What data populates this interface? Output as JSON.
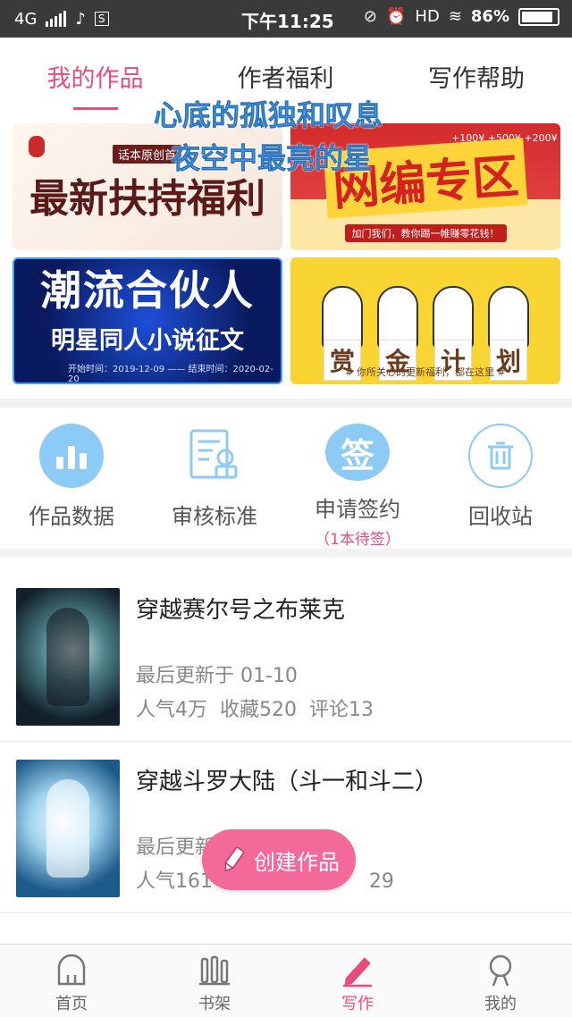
{
  "status_bar": {
    "network": "4G",
    "time": "下午11:25",
    "hd": "HD",
    "battery": "86%"
  },
  "tabs": [
    {
      "label": "我的作品",
      "active": true
    },
    {
      "label": "作者福利",
      "active": false
    },
    {
      "label": "写作帮助",
      "active": false
    }
  ],
  "overlay_lyrics": [
    "心底的孤独和叹息",
    "夜空中最亮的星"
  ],
  "banners": {
    "b1": {
      "title": "最新扶持福利",
      "tag": "话本原创首"
    },
    "b2": {
      "title": "网编专区",
      "coins": "+100¥  +500¥  +200¥",
      "subtitle": "加门我们，教你踢一帷赚零花钱！"
    },
    "b3": {
      "title": "潮流合伙人",
      "subtitle": "明星同人小说征文",
      "dates": "开始时间：2019-12-09 —— 结束时间：2020-02-20"
    },
    "b4": {
      "chars": [
        "赏",
        "金",
        "计",
        "划"
      ],
      "subtitle": "# 你所关心的更新福利，都在这里 #"
    }
  },
  "tools": [
    {
      "label": "作品数据",
      "icon": "bar-chart-icon"
    },
    {
      "label": "审核标准",
      "icon": "document-check-icon"
    },
    {
      "label": "申请签约",
      "icon": "sign-icon",
      "icon_char": "签",
      "sub": "（1本待签）"
    },
    {
      "label": "回收站",
      "icon": "trash-icon"
    }
  ],
  "works": [
    {
      "title": "穿越赛尔号之布莱克",
      "updated": "最后更新于 01-10",
      "stats": "人气4万  收藏520  评论13"
    },
    {
      "title": "穿越斗罗大陆（斗一和斗二）",
      "updated": "最后更新",
      "stats": "人气161                         29"
    }
  ],
  "fab": {
    "label": "创建作品"
  },
  "bottom_nav": [
    {
      "label": "首页",
      "icon": "home-icon",
      "active": false
    },
    {
      "label": "书架",
      "icon": "bookshelf-icon",
      "active": false
    },
    {
      "label": "写作",
      "icon": "pen-icon",
      "active": true
    },
    {
      "label": "我的",
      "icon": "profile-icon",
      "active": false
    }
  ],
  "colors": {
    "accent": "#e84c7a",
    "tool_blue": "#8ccbf5",
    "fab": "#f36a9a"
  }
}
